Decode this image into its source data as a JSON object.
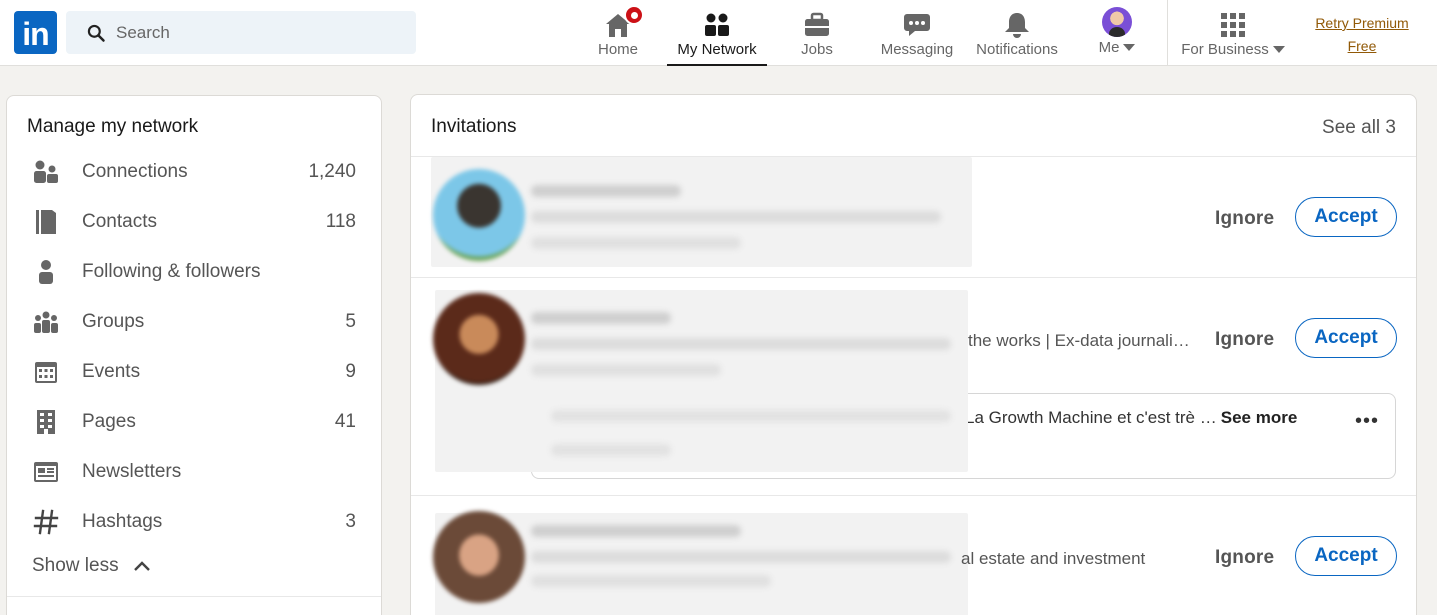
{
  "nav": {
    "logo_text": "in",
    "search_placeholder": "Search",
    "items": [
      {
        "label": "Home",
        "icon": "home-icon"
      },
      {
        "label": "My Network",
        "icon": "people-icon",
        "active": true
      },
      {
        "label": "Jobs",
        "icon": "briefcase-icon"
      },
      {
        "label": "Messaging",
        "icon": "chat-icon"
      },
      {
        "label": "Notifications",
        "icon": "bell-icon"
      },
      {
        "label": "Me",
        "icon": "avatar"
      },
      {
        "label": "For Business",
        "icon": "grid-icon"
      }
    ],
    "premium_line1": "Retry Premium",
    "premium_line2": "Free",
    "colors": {
      "brand": "#0a66c2",
      "notification": "#cc1016",
      "premium": "#915907"
    }
  },
  "left": {
    "title": "Manage my network",
    "items": [
      {
        "label": "Connections",
        "count": "1,240",
        "icon": "connections-icon"
      },
      {
        "label": "Contacts",
        "count": "118",
        "icon": "contacts-book-icon"
      },
      {
        "label": "Following & followers",
        "count": "",
        "icon": "person-icon"
      },
      {
        "label": "Groups",
        "count": "5",
        "icon": "groups-icon"
      },
      {
        "label": "Events",
        "count": "9",
        "icon": "calendar-icon"
      },
      {
        "label": "Pages",
        "count": "41",
        "icon": "building-icon"
      },
      {
        "label": "Newsletters",
        "count": "",
        "icon": "newspaper-icon"
      },
      {
        "label": "Hashtags",
        "count": "3",
        "icon": "hashtag-icon"
      }
    ],
    "show_less": "Show less"
  },
  "invitations": {
    "title": "Invitations",
    "see_all": "See all 3",
    "ignore_label": "Ignore",
    "accept_label": "Accept",
    "cards": [
      {
        "visible_text": ""
      },
      {
        "visible_text": "the works | Ex-data journali…",
        "message": "La Growth Machine et c'est trè …",
        "see_more": "See more"
      },
      {
        "visible_text": "al estate and investment"
      }
    ]
  }
}
